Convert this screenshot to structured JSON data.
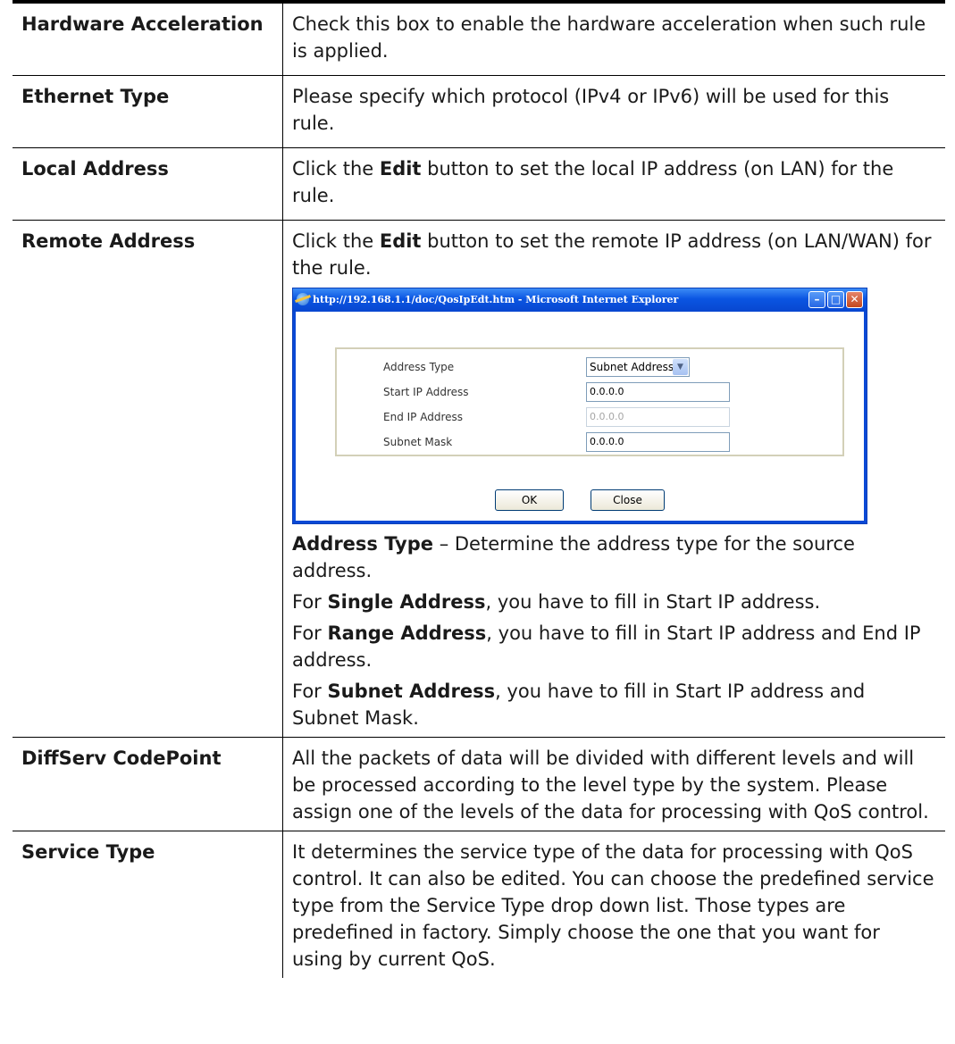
{
  "rows": [
    {
      "key": "Hardware Acceleration",
      "desc": "Check this box to enable the hardware acceleration when such rule is applied."
    },
    {
      "key": "Ethernet Type",
      "desc": "Please specify which protocol (IPv4 or IPv6) will be used for this rule."
    },
    {
      "key": "Local Address",
      "desc_pre": "Click the ",
      "desc_bold": "Edit",
      "desc_post": " button to set the local IP address (on LAN) for the rule."
    },
    {
      "key": "Remote Address",
      "desc_pre": "Click the ",
      "desc_bold": "Edit",
      "desc_post": " button to set the remote IP address (on LAN/WAN) for the rule."
    },
    {
      "key": "DiffServ CodePoint",
      "desc": "All the packets of data will be divided with different levels and will be processed according to the level type by the system. Please assign one of the levels of the data for processing with QoS control."
    },
    {
      "key": "Service Type",
      "desc": "It determines the service type of the data for processing with QoS control. It can also be edited. You can choose the predefined service type from the Service Type drop down list. Those types are predefined in factory. Simply choose the one that you want for using by current QoS."
    }
  ],
  "popup": {
    "title": "http://192.168.1.1/doc/QosIpEdt.htm - Microsoft Internet Explorer",
    "fields": {
      "address_type_label": "Address Type",
      "address_type_value": "Subnet Address",
      "start_ip_label": "Start IP Address",
      "start_ip_value": "0.0.0.0",
      "end_ip_label": "End IP Address",
      "end_ip_value": "0.0.0.0",
      "subnet_mask_label": "Subnet Mask",
      "subnet_mask_value": "0.0.0.0"
    },
    "ok_label": "OK",
    "close_label": "Close",
    "icons": [
      "ie-logo-icon",
      "minimize-icon",
      "maximize-icon",
      "close-icon"
    ]
  },
  "remote_notes": {
    "address_type_term": "Address Type",
    "address_type_desc": " – Determine the address type for the source address.",
    "single_pre": "For ",
    "single_term": "Single Address",
    "single_post": ", you have to fill in Start IP address.",
    "range_pre": "For ",
    "range_term": "Range Address",
    "range_post": ", you have to fill in Start IP address and End IP address.",
    "subnet_pre": "For ",
    "subnet_term": "Subnet Address",
    "subnet_post": ", you have to fill in Start IP address and Subnet Mask."
  }
}
